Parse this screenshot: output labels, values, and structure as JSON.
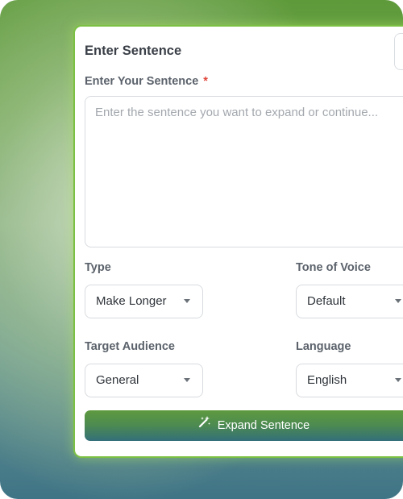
{
  "form": {
    "title": "Enter Sentence",
    "sentence_label": "Enter Your Sentence",
    "required_mark": "*",
    "sentence_placeholder": "Enter the sentence you want to expand or continue...",
    "type_label": "Type",
    "type_value": "Make Longer",
    "tone_label": "Tone of Voice",
    "tone_value": "Default",
    "audience_label": "Target Audience",
    "audience_value": "General",
    "language_label": "Language",
    "language_value": "English",
    "submit_label": "Expand Sentence"
  },
  "icons": {
    "submit_icon": "magic-wand-icon",
    "dropdown_icon": "caret-down-icon"
  },
  "colors": {
    "card_border": "#7bc043",
    "required": "#e0453a",
    "button_top": "#5f9a3e",
    "button_bottom": "#336f7a"
  }
}
